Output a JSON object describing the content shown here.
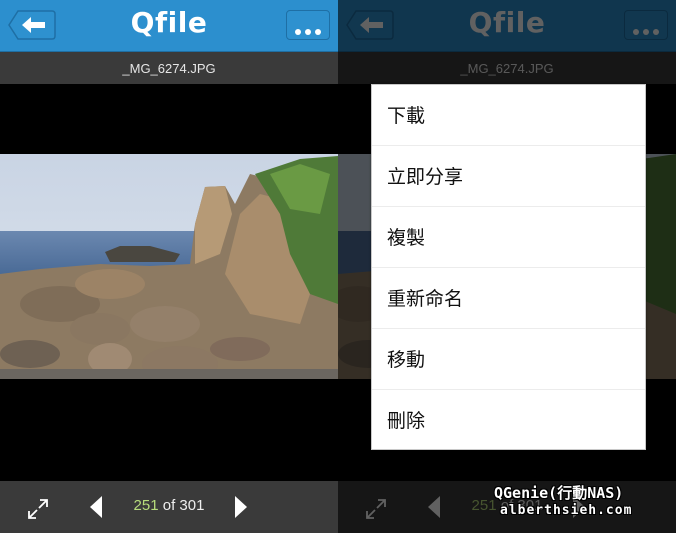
{
  "app": {
    "title": "Qfile",
    "file_name": "_MG_6274.JPG",
    "accent_color": "#2c8fce"
  },
  "header": {
    "back_icon": "back-arrow-icon",
    "more_icon": "more-dots-icon"
  },
  "viewer": {
    "photo_description": "Rocky coastline with layered sandstone formations and sea",
    "current_index": "251",
    "of_label": "of",
    "total": "301",
    "expand_icon": "expand-icon",
    "prev_icon": "prev-triangle-icon",
    "next_icon": "next-triangle-icon"
  },
  "context_menu": {
    "items": [
      {
        "label": "下載"
      },
      {
        "label": "立即分享"
      },
      {
        "label": "複製"
      },
      {
        "label": "重新命名"
      },
      {
        "label": "移動"
      },
      {
        "label": "刪除"
      }
    ]
  },
  "watermark": {
    "line1": "QGenie(行動NAS)",
    "line2": "alberthsieh.com"
  }
}
